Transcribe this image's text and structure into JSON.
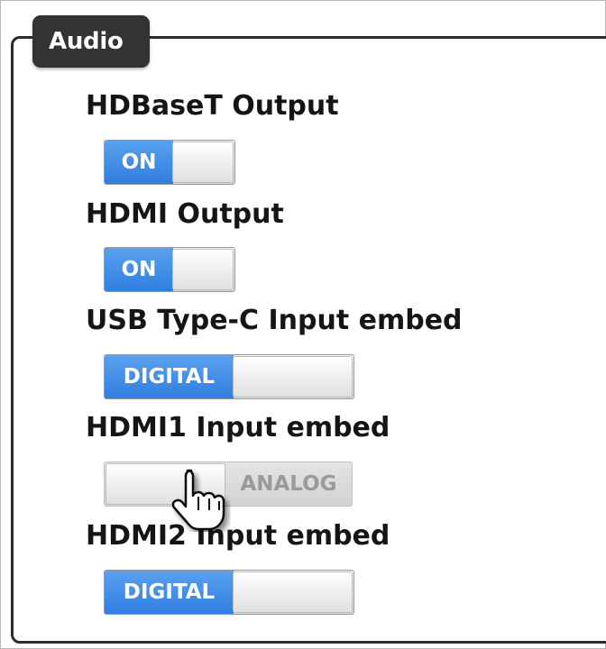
{
  "panel": {
    "title": "Audio"
  },
  "rows": [
    {
      "label": "HDBaseT Output",
      "state": "on",
      "text": "ON"
    },
    {
      "label": "HDMI Output",
      "state": "on",
      "text": "ON"
    },
    {
      "label": "USB Type-C Input embed",
      "state": "on",
      "text": "DIGITAL"
    },
    {
      "label": "HDMI1 Input embed",
      "state": "off",
      "text": "ANALOG"
    },
    {
      "label": "HDMI2 Input embed",
      "state": "on",
      "text": "DIGITAL"
    }
  ],
  "colors": {
    "toggle_on": "#3f8ce8",
    "legend_bg": "#333333"
  },
  "icons": {
    "cursor": "hand-pointer-icon"
  }
}
